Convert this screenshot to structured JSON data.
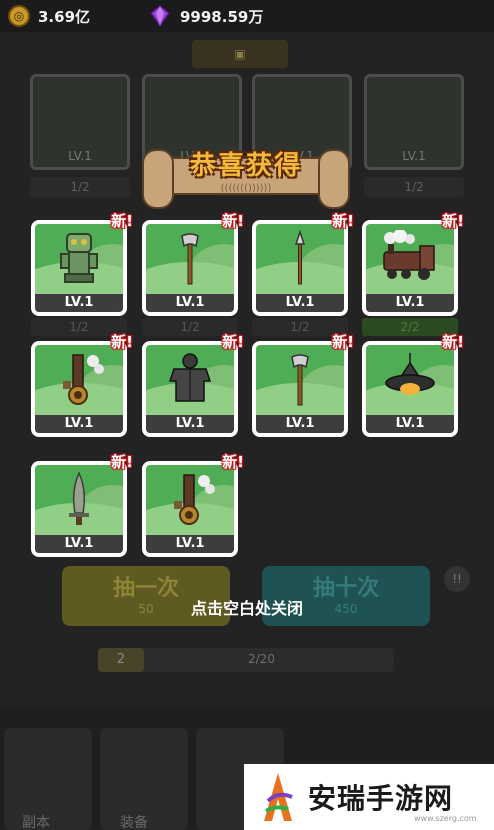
{
  "topbar": {
    "coin": {
      "icon": "coin-icon",
      "value": "3.69亿"
    },
    "gem": {
      "icon": "gem-icon",
      "value": "9998.59万"
    }
  },
  "background": {
    "cards": [
      {
        "level": "LV.1",
        "count": "1/2"
      },
      {
        "level": "LV.1",
        "count": "1/2"
      },
      {
        "level": "LV.1",
        "count": "1/2"
      },
      {
        "level": "LV.1",
        "count": "1/2"
      }
    ],
    "draw_one": {
      "label": "抽一次",
      "cost": "50"
    },
    "draw_ten": {
      "label": "抽十次",
      "cost": "450"
    },
    "progress": {
      "level": "2",
      "text": "2/20"
    },
    "tabs": [
      "副本",
      "装备",
      "",
      ""
    ]
  },
  "banner": {
    "title": "恭喜获得",
    "subtitle": "((((((())))))"
  },
  "rewards": [
    {
      "name": "jade-idol",
      "level": "LV.1",
      "badge": "新!",
      "under": "1/2"
    },
    {
      "name": "axe",
      "level": "LV.1",
      "badge": "新!",
      "under": "1/2"
    },
    {
      "name": "spear",
      "level": "LV.1",
      "badge": "新!",
      "under": "1/2"
    },
    {
      "name": "steam-train",
      "level": "LV.1",
      "badge": "新!",
      "under": "2/2"
    },
    {
      "name": "steam-cannon",
      "level": "LV.1",
      "badge": "新!"
    },
    {
      "name": "armor",
      "level": "LV.1",
      "badge": "新!"
    },
    {
      "name": "axe",
      "level": "LV.1",
      "badge": "新!"
    },
    {
      "name": "lamp-hat",
      "level": "LV.1",
      "badge": "新!"
    },
    {
      "name": "stone-sword",
      "level": "LV.1",
      "badge": "新!"
    },
    {
      "name": "steam-cannon",
      "level": "LV.1",
      "badge": "新!"
    }
  ],
  "hint": "点击空白处关闭",
  "watermark": {
    "text": "安瑞手游网",
    "url": "www.szerg.com"
  },
  "colors": {
    "card_bg": "#4fae55",
    "badge": "#c4161c",
    "banner_text": "#f5b93c"
  }
}
